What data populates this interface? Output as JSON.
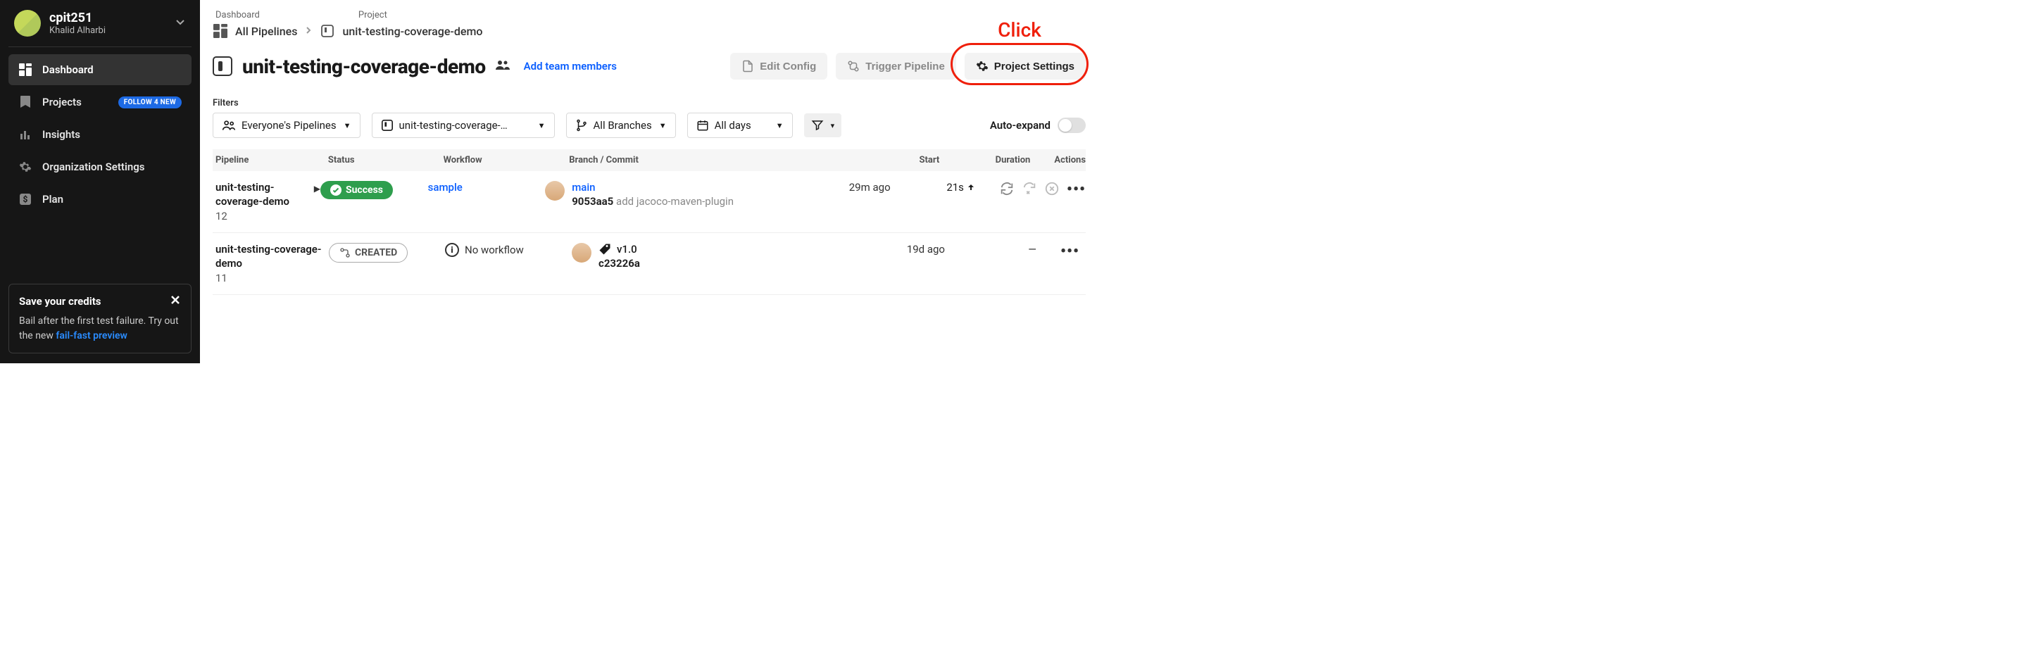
{
  "org": {
    "name": "cpit251",
    "subtitle": "Khalid Alharbi"
  },
  "sidebar": {
    "items": [
      {
        "label": "Dashboard"
      },
      {
        "label": "Projects",
        "badge": "FOLLOW 4 NEW"
      },
      {
        "label": "Insights"
      },
      {
        "label": "Organization Settings"
      },
      {
        "label": "Plan"
      }
    ],
    "promo": {
      "title": "Save your credits",
      "body": "Bail after the first test failure. Try out the new ",
      "link": "fail-fast preview"
    }
  },
  "breadcrumb": {
    "dashboard_label": "Dashboard",
    "project_label": "Project",
    "all_pipelines": "All Pipelines",
    "project_name": "unit-testing-coverage-demo"
  },
  "header": {
    "title": "unit-testing-coverage-demo",
    "add_team": "Add team members",
    "edit_config": "Edit Config",
    "trigger": "Trigger Pipeline",
    "settings": "Project Settings"
  },
  "filters": {
    "label": "Filters",
    "scope": "Everyone's Pipelines",
    "project": "unit-testing-coverage-…",
    "branches": "All Branches",
    "days": "All days",
    "auto_expand": "Auto-expand"
  },
  "columns": {
    "pipeline": "Pipeline",
    "status": "Status",
    "workflow": "Workflow",
    "branch": "Branch / Commit",
    "start": "Start",
    "duration": "Duration",
    "actions": "Actions"
  },
  "rows": [
    {
      "name": "unit-testing-coverage-demo",
      "num": "12",
      "status": "Success",
      "status_type": "success",
      "workflow": "sample",
      "workflow_link": true,
      "branch": "main",
      "is_tag": false,
      "commit_hash": "9053aa5",
      "commit_msg": "add jacoco-maven-plugin",
      "start": "29m ago",
      "duration": "21s",
      "has_arrow": true,
      "full_actions": true
    },
    {
      "name": "unit-testing-coverage-demo",
      "num": "11",
      "status": "CREATED",
      "status_type": "created",
      "workflow": "No workflow",
      "workflow_link": false,
      "branch": "v1.0",
      "is_tag": true,
      "commit_hash": "c23226a",
      "commit_msg": "",
      "start": "19d ago",
      "duration": "—",
      "has_arrow": false,
      "full_actions": false
    }
  ],
  "annotation": {
    "text": "Click"
  }
}
